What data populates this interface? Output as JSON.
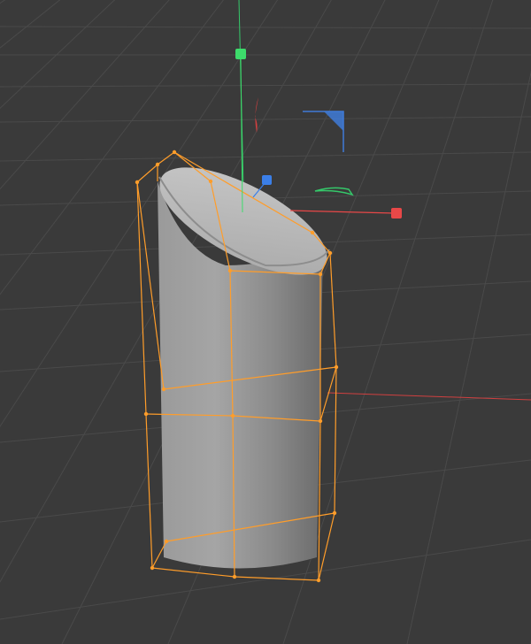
{
  "viewport": {
    "name": "3d-viewport",
    "background_color": "#3a3a3a",
    "grid_color": "#4a4a4a",
    "selection_color": "#ff9d2a"
  },
  "axes": {
    "x_axis_color": "#d04040",
    "y_axis_color": "#35c86a",
    "z_axis_color": "#3f7bd8"
  },
  "gizmo": {
    "handles": [
      {
        "name": "x-move-handle",
        "color": "#e84848"
      },
      {
        "name": "y-move-handle",
        "color": "#3ddc6b"
      },
      {
        "name": "z-move-handle",
        "color": "#3b7fe8"
      }
    ],
    "rotate_arcs": [
      {
        "name": "x-rotate-arc",
        "color": "#d04040"
      },
      {
        "name": "y-rotate-arc",
        "color": "#35c86a"
      },
      {
        "name": "z-plane-handle",
        "color": "#3f7bd8"
      }
    ]
  },
  "object": {
    "name": "cylinder-object",
    "type": "slanted cylinder",
    "selected": true
  }
}
